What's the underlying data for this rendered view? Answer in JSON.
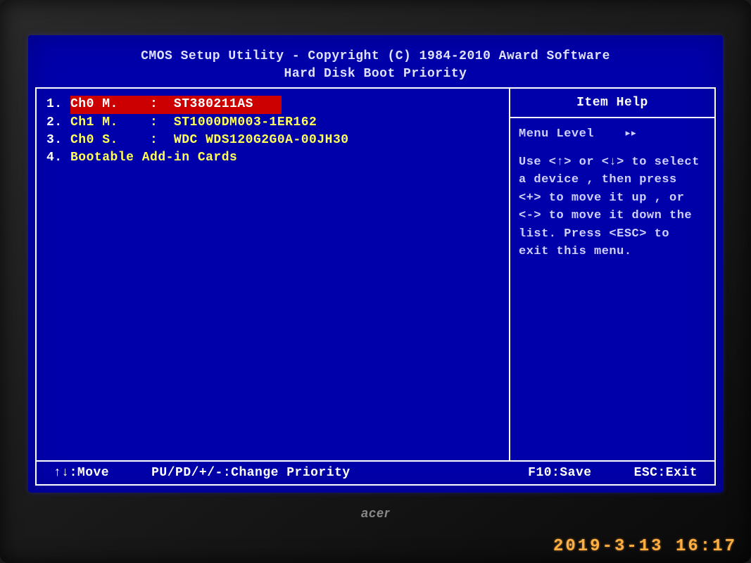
{
  "header": {
    "line1": "CMOS Setup Utility - Copyright (C) 1984-2010 Award Software",
    "line2": "Hard Disk Boot Priority"
  },
  "boot_items": [
    {
      "num": "1.",
      "label": "Ch0 M.    :  ST380211AS",
      "selected": true
    },
    {
      "num": "2.",
      "label": "Ch1 M.    :  ST1000DM003-1ER162",
      "selected": false
    },
    {
      "num": "3.",
      "label": "Ch0 S.    :  WDC WDS120G2G0A-00JH30",
      "selected": false
    },
    {
      "num": "4.",
      "label": "Bootable Add-in Cards",
      "selected": false
    }
  ],
  "help": {
    "title": "Item Help",
    "menu_level_label": "Menu Level",
    "menu_level_icon": "▸▸",
    "text": "Use <↑> or <↓> to select a device , then press <+> to move it up , or <-> to move it down the list. Press <ESC> to exit this menu."
  },
  "footer": {
    "move": "↑↓:Move",
    "change": "PU/PD/+/-:Change Priority",
    "save": "F10:Save",
    "exit": "ESC:Exit"
  },
  "monitor_brand": "acer",
  "camera_timestamp": "2019-3-13 16:17"
}
